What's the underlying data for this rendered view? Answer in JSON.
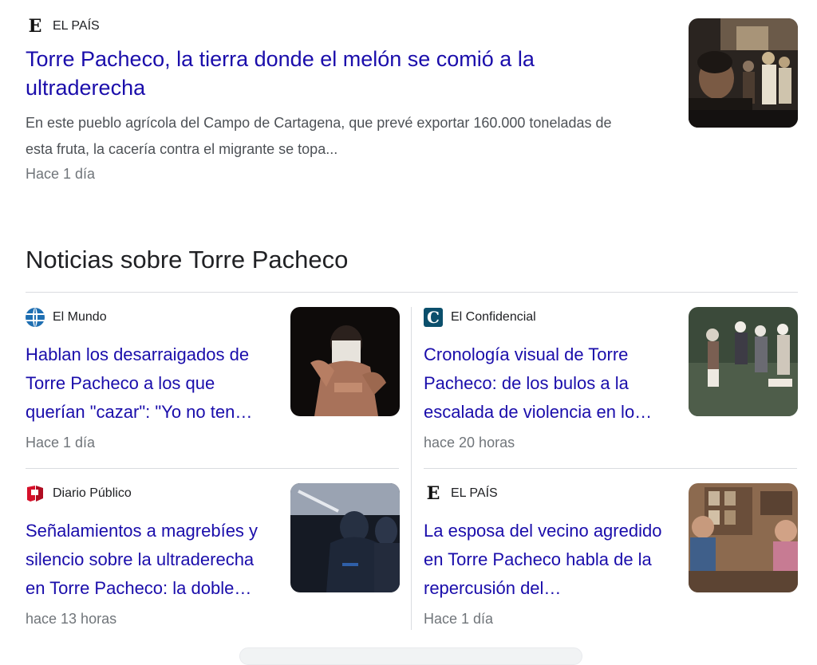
{
  "top_result": {
    "source": "EL PAÍS",
    "title": "Torre Pacheco, la tierra donde el melón se comió a la ultraderecha",
    "snippet": "En este pueblo agrícola del Campo de Cartagena, que prevé exportar 160.000 toneladas de esta fruta, la cacería contra el migrante se topa...",
    "time": "Hace 1 día",
    "logo_letter": "E",
    "thumbnail_icon": "photo-thumbnail-icon"
  },
  "news_section": {
    "title": "Noticias sobre Torre Pacheco",
    "cards": [
      {
        "source": "El Mundo",
        "title": "Hablan los desarraigados de Torre Pacheco a los que querían \"cazar\": \"Yo no ten…",
        "time": "Hace 1 día",
        "logo_icon": "el-mundo-globe-icon"
      },
      {
        "source": "El Confidencial",
        "title": "Cronología visual de Torre Pacheco: de los bulos a la escalada de violencia en lo…",
        "time": "hace 20 horas",
        "logo_icon": "el-confidencial-logo-icon",
        "logo_letter": "C"
      },
      {
        "source": "Diario Público",
        "title": "Señalamientos a magrebíes y silencio sobre la ultraderecha en Torre Pacheco: la doble…",
        "time": "hace 13 horas",
        "logo_icon": "diario-publico-logo-icon"
      },
      {
        "source": "EL PAÍS",
        "title": "La esposa del vecino agredido en Torre Pacheco habla de la repercusión del…",
        "time": "Hace 1 día",
        "logo_icon": "el-pais-logo-icon",
        "logo_letter": "E"
      }
    ]
  },
  "colors": {
    "link": "#1a0dab",
    "snippet": "#4d5156",
    "meta": "#70757a",
    "divider": "#dadce0"
  }
}
